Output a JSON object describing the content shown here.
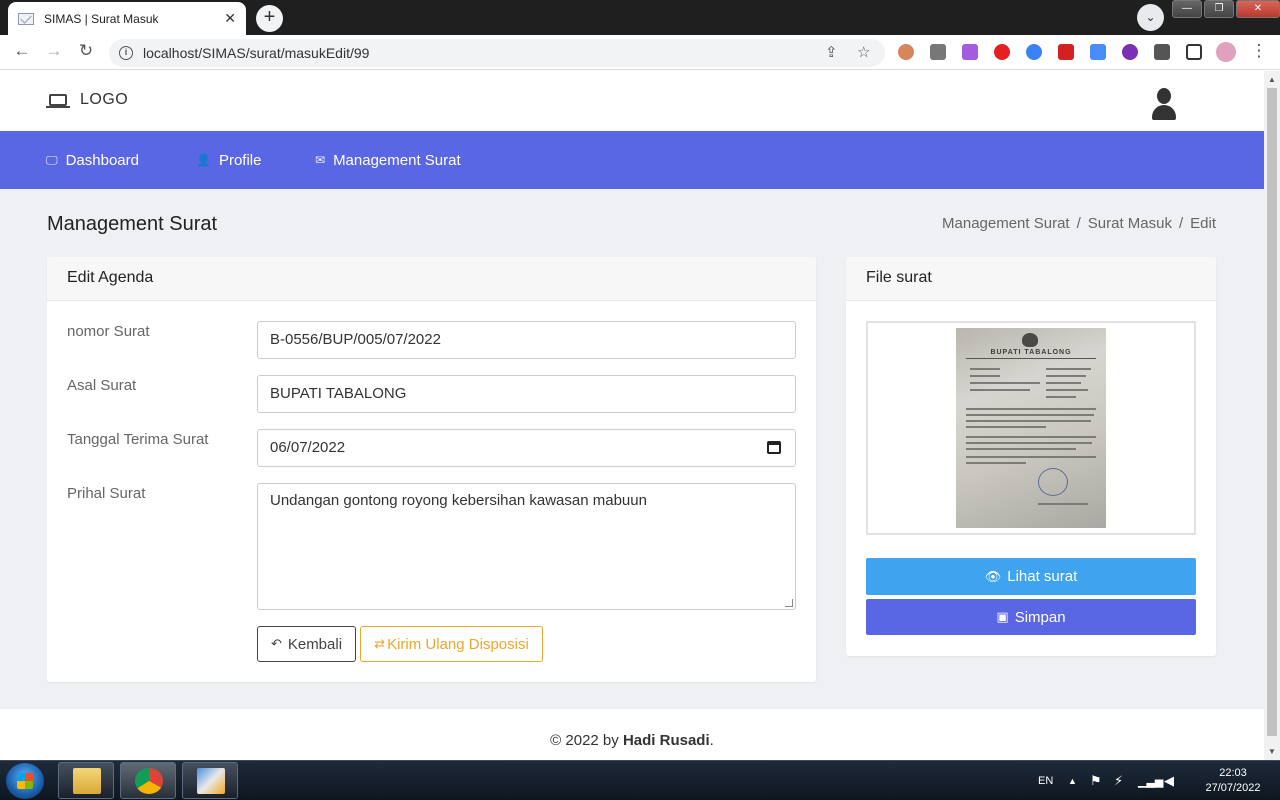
{
  "browser": {
    "tab_title": "SIMAS | Surat Masuk",
    "tab_close": "✕",
    "new_tab": "+",
    "url": "localhost/SIMAS/surat/masukEdit/99"
  },
  "header": {
    "logo_text": "LOGO"
  },
  "nav": {
    "items": [
      {
        "label": "Dashboard",
        "icon": "monitor-icon"
      },
      {
        "label": "Profile",
        "icon": "user-icon"
      },
      {
        "label": "Management Surat",
        "icon": "mail-icon"
      }
    ]
  },
  "page": {
    "title": "Management Surat",
    "breadcrumb": [
      "Management Surat",
      "Surat Masuk",
      "Edit"
    ]
  },
  "form": {
    "card_title": "Edit Agenda",
    "nomor_label": "nomor Surat",
    "nomor_value": "B-0556/BUP/005/07/2022",
    "asal_label": "Asal Surat",
    "asal_value": "BUPATI TABALONG",
    "tanggal_label": "Tanggal Terima Surat",
    "tanggal_value": "06/07/2022",
    "prihal_label": "Prihal Surat",
    "prihal_value": "Undangan gontong royong kebersihan kawasan mabuun",
    "back_label": "Kembali",
    "resend_label": "Kirim Ulang Disposisi"
  },
  "file": {
    "card_title": "File surat",
    "document_heading": "BUPATI TABALONG",
    "view_label": "Lihat surat",
    "save_label": "Simpan"
  },
  "footer": {
    "prefix": "© 2022 by ",
    "author": "Hadi Rusadi",
    "suffix": "."
  },
  "taskbar": {
    "lang": "EN",
    "time": "22:03",
    "date": "27/07/2022"
  },
  "colors": {
    "nav_bg": "#5a67e4",
    "page_bg": "#eef0f3",
    "view_button": "#3fa3ef",
    "save_button": "#5a67e4",
    "resend_button": "#e8a72f"
  }
}
